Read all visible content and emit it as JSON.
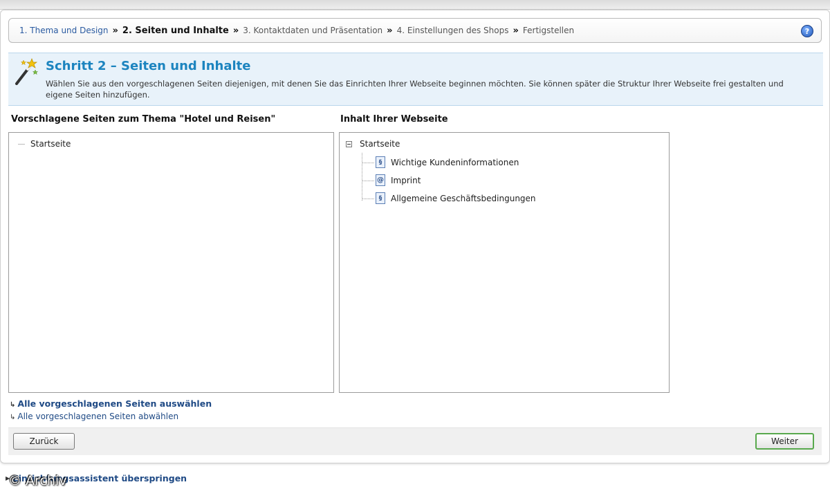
{
  "breadcrumb": {
    "steps": [
      "1. Thema und Design",
      "2. Seiten und Inhalte",
      "3. Kontaktdaten und Präsentation",
      "4. Einstellungen des Shops",
      "Fertigstellen"
    ],
    "separator": "»",
    "help_icon": "help-icon",
    "help_symbol": "?"
  },
  "step": {
    "title": "Schritt 2 – Seiten und Inhalte",
    "description": "Wählen Sie aus den vorgeschlagenen Seiten diejenigen, mit denen Sie das Einrichten Ihrer Webseite beginnen möchten. Sie können später die Struktur Ihrer Webseite frei gestalten und eigene Seiten hinzufügen.",
    "icon": "magic-wand-icon"
  },
  "suggested_pages": {
    "heading": "Vorschlagene Seiten zum Thema \"Hotel und Reisen\"",
    "items": [
      "Startseite"
    ]
  },
  "website_content": {
    "heading": "Inhalt Ihrer Webseite",
    "root": "Startseite",
    "children": [
      {
        "label": "Wichtige Kundeninformationen",
        "icon": "page-icon",
        "symbol": "§"
      },
      {
        "label": "Imprint",
        "icon": "email-page-icon",
        "symbol": "@"
      },
      {
        "label": "Allgemeine Geschäftsbedingungen",
        "icon": "page-icon",
        "symbol": "§"
      }
    ]
  },
  "links": {
    "select_all": "Alle vorgeschlagenen Seiten auswählen",
    "deselect_all": "Alle vorgeschlagenen Seiten abwählen",
    "arrow_symbol": "↳"
  },
  "buttons": {
    "back": "Zurück",
    "next": "Weiter"
  },
  "footer": {
    "skip_link": "Einrichtungsassistent überspringen",
    "watermark": "© Archiv"
  },
  "colors": {
    "title_blue": "#1c84bf",
    "link_blue": "#1f4a85",
    "header_bg": "#e8f2fa",
    "next_border": "#58a94d"
  }
}
